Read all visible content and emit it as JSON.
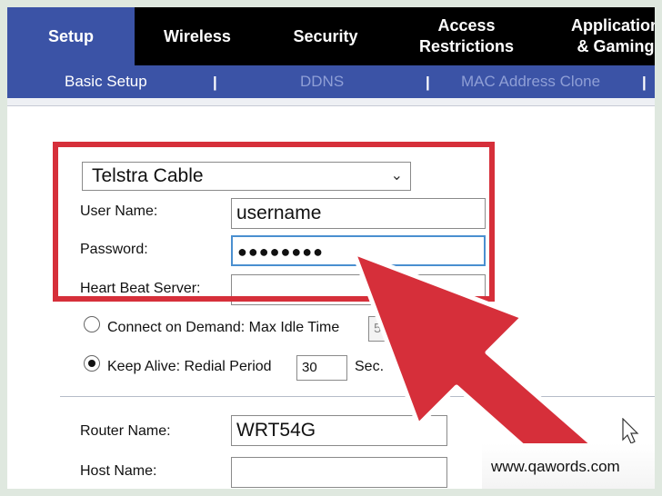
{
  "tabs": [
    {
      "label": "Setup",
      "active": true
    },
    {
      "label": "Wireless",
      "active": false
    },
    {
      "label": "Security",
      "active": false
    },
    {
      "label": "Access\nRestrictions",
      "active": false
    },
    {
      "label": "Application\n& Gaming",
      "active": false
    }
  ],
  "subnav": {
    "basic_setup": "Basic Setup",
    "ddns": "DDNS",
    "mac_clone": "MAC Address Clone",
    "separator": "|"
  },
  "connection": {
    "type_selected": "Telstra Cable",
    "user_name_label": "User Name:",
    "user_name_value": "username",
    "password_label": "Password:",
    "password_value": "●●●●●●●●",
    "heartbeat_label": "Heart Beat Server:",
    "heartbeat_value": ""
  },
  "connect_on_demand": {
    "label": "Connect on Demand: Max Idle Time",
    "value": "5",
    "selected": false
  },
  "keep_alive": {
    "label": "Keep Alive: Redial Period",
    "value": "30",
    "unit": "Sec.",
    "selected": true
  },
  "router": {
    "router_name_label": "Router Name:",
    "router_name_value": "WRT54G",
    "host_name_label": "Host Name:",
    "host_name_value": ""
  },
  "watermark": "www.qawords.com",
  "colors": {
    "tab_bar": "#000000",
    "active_tab": "#3b53a6",
    "highlight_box": "#d62f3a",
    "arrow": "#d62f3a"
  },
  "icons": [
    "chevron-down-icon",
    "pointer-arrow-icon",
    "mouse-cursor-icon"
  ]
}
